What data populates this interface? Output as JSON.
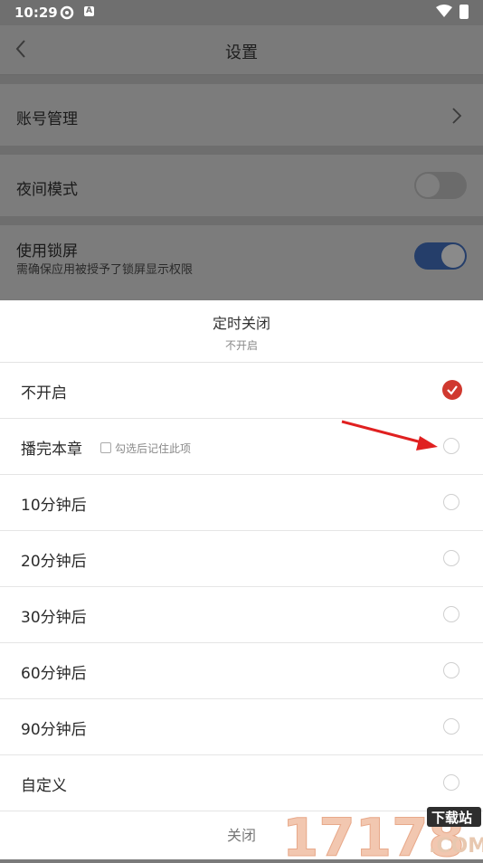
{
  "status_bar": {
    "time": "10:29",
    "icon_b_letter": "A"
  },
  "header": {
    "title": "设置"
  },
  "settings": {
    "account": {
      "label": "账号管理"
    },
    "night_mode": {
      "label": "夜间模式",
      "enabled": false
    },
    "lock_screen": {
      "label": "使用锁屏",
      "description": "需确保应用被授予了锁屏显示权限",
      "enabled": true
    }
  },
  "sheet": {
    "title": "定时关闭",
    "subtitle": "不开启",
    "remember_label": "勾选后记住此项",
    "options": [
      {
        "label": "不开启",
        "selected": true
      },
      {
        "label": "播完本章",
        "selected": false
      },
      {
        "label": "10分钟后",
        "selected": false
      },
      {
        "label": "20分钟后",
        "selected": false
      },
      {
        "label": "30分钟后",
        "selected": false
      },
      {
        "label": "60分钟后",
        "selected": false
      },
      {
        "label": "90分钟后",
        "selected": false
      },
      {
        "label": "自定义",
        "selected": false
      }
    ],
    "close_label": "关闭"
  },
  "watermark": {
    "number": "17178",
    "tag": "下载站",
    "suffix": ".COM"
  },
  "colors": {
    "accent": "#d0392f",
    "toggle_on": "#253e6a",
    "arrow": "#e02020"
  }
}
